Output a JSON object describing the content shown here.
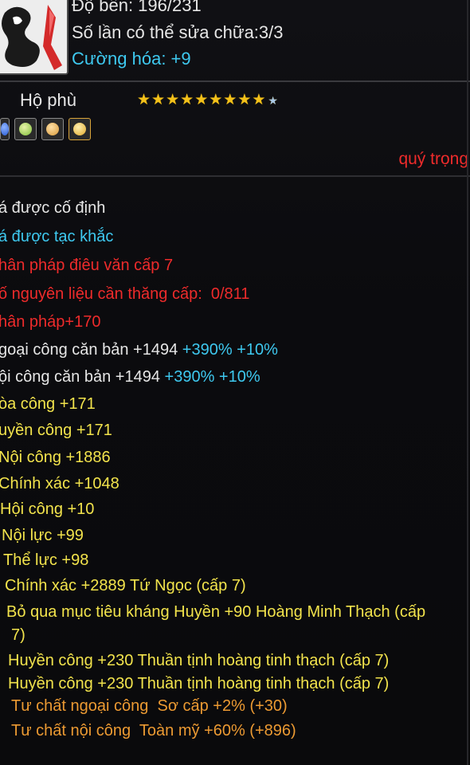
{
  "header": {
    "durability": "Độ bền: 196/231",
    "repairs": "Số lần có thể sửa chữa:3/3",
    "enhance": "Cường hóa: +9"
  },
  "stars": {
    "label": "Hộ phù",
    "filled": 9,
    "empty": 1
  },
  "gems": [
    "blue-gem-icon",
    "green-gem-icon",
    "amber-gem-icon",
    "gold-gem-icon"
  ],
  "quality_label": "quý trọng",
  "stats": [
    {
      "text": "á được cố định",
      "color": "white"
    },
    {
      "text": "á được tạc khắc",
      "color": "cyan"
    },
    {
      "text": "hân pháp điêu văn cấp 7",
      "color": "red"
    },
    {
      "text": "ố nguyên liệu cần thăng cấp:  0/811",
      "color": "red"
    },
    {
      "text": "hân pháp+170",
      "color": "red"
    },
    {
      "text": "goại công căn bản +1494 ",
      "extra": "+390% +10%",
      "color": "white"
    },
    {
      "text": "ội công căn bản +1494 ",
      "extra": "+390% +10%",
      "color": "white"
    },
    {
      "text": "òa công +171",
      "color": "yellow"
    },
    {
      "text": "uyền công +171",
      "color": "yellow"
    },
    {
      "text": "Nội công +1886",
      "color": "yellow"
    },
    {
      "text": "Chính xác +1048",
      "color": "yellow"
    },
    {
      "text": "Hội công +10",
      "color": "yellow"
    },
    {
      "text": "Nội lực +99",
      "color": "yellow"
    },
    {
      "text": "Thể lực +98",
      "color": "yellow"
    },
    {
      "text": "Chính xác +2889 Tứ Ngọc (cấp 7)",
      "color": "yellow"
    },
    {
      "text": "Bỏ qua mục tiêu kháng Huyền +90 Hoàng Minh Thạch (cấp",
      "color": "yellow"
    },
    {
      "text": "7)",
      "color": "yellow"
    },
    {
      "text": "Huyền công +230 Thuần tịnh hoàng tinh thạch (cấp 7)",
      "color": "yellow"
    },
    {
      "text": "Huyền công +230 Thuần tịnh hoàng tinh thạch (cấp 7)",
      "color": "yellow"
    },
    {
      "text": "Tư chất ngoại công  Sơ cấp +2% (+30)",
      "color": "orange"
    },
    {
      "text": "Tư chất nội công  Toàn mỹ +60% (+896)",
      "color": "orange"
    }
  ]
}
